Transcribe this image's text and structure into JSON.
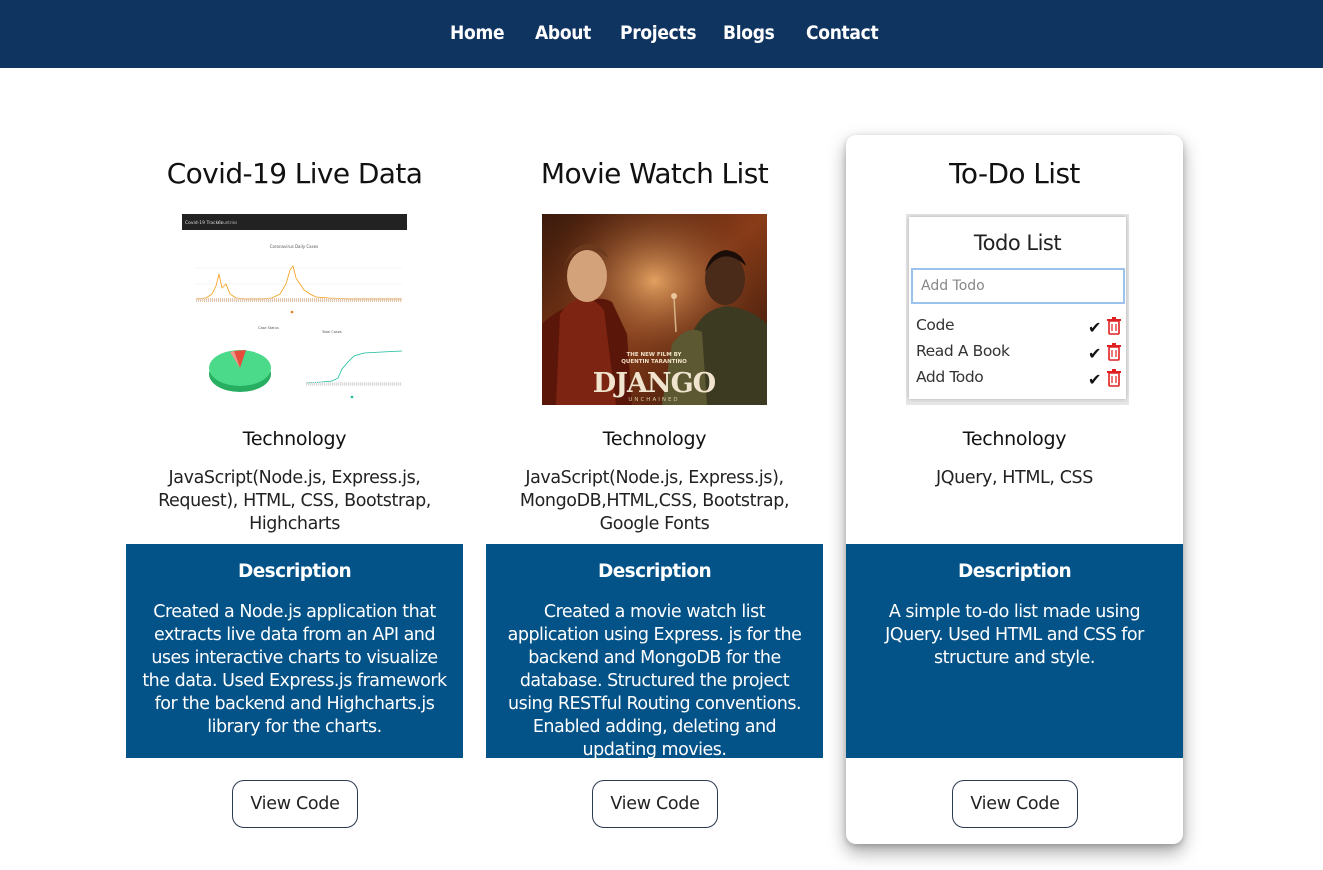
{
  "nav": {
    "items": [
      {
        "label": "Home"
      },
      {
        "label": "About"
      },
      {
        "label": "Projects"
      },
      {
        "label": "Blogs"
      },
      {
        "label": "Contact"
      }
    ]
  },
  "projects": [
    {
      "title": "Covid-19 Live Data",
      "thumbnail": {
        "kind": "chart-dashboard-screenshot",
        "header_texts": [
          "Covid-19 Tracker",
          "Countries"
        ],
        "chart_titles": [
          "Coronavirus Daily Cases",
          "Case Status",
          "Total Cases"
        ]
      },
      "tech_heading": "Technology",
      "tech": "JavaScript(Node.js, Express.js, Request), HTML, CSS, Bootstrap, Highcharts",
      "desc_heading": "Description",
      "description": "Created a Node.js application that extracts live data from an API and uses interactive charts to visualize the data. Used Express.js framework for the backend and Highcharts.js library for the charts.",
      "button_label": "View Code"
    },
    {
      "title": "Movie Watch List",
      "thumbnail": {
        "kind": "movie-poster",
        "tagline_line1": "THE NEW FILM BY",
        "tagline_line2": "QUENTIN TARANTINO",
        "poster_title": "DJANGO",
        "poster_subtitle": "UNCHAINED"
      },
      "tech_heading": "Technology",
      "tech": "JavaScript(Node.js, Express.js), MongoDB,HTML,CSS, Bootstrap, Google Fonts",
      "desc_heading": "Description",
      "description": "Created a movie watch list application using Express. js for the backend and MongoDB for the database. Structured the project using RESTful Routing conventions. Enabled adding, deleting and updating movies.",
      "button_label": "View Code"
    },
    {
      "title": "To-Do List",
      "thumbnail": {
        "kind": "todo-app-screenshot",
        "app_title": "Todo List",
        "input_placeholder": "Add Todo",
        "items": [
          "Code",
          "Read A Book",
          "Add Todo"
        ]
      },
      "tech_heading": "Technology",
      "tech": "JQuery, HTML, CSS",
      "desc_heading": "Description",
      "description": "A simple to-do list made using JQuery. Used HTML and CSS for structure and style.",
      "button_label": "View Code"
    }
  ],
  "colors": {
    "navbar": "#0f3460",
    "description_bg": "#035288",
    "button_border": "#2a3a4f"
  }
}
